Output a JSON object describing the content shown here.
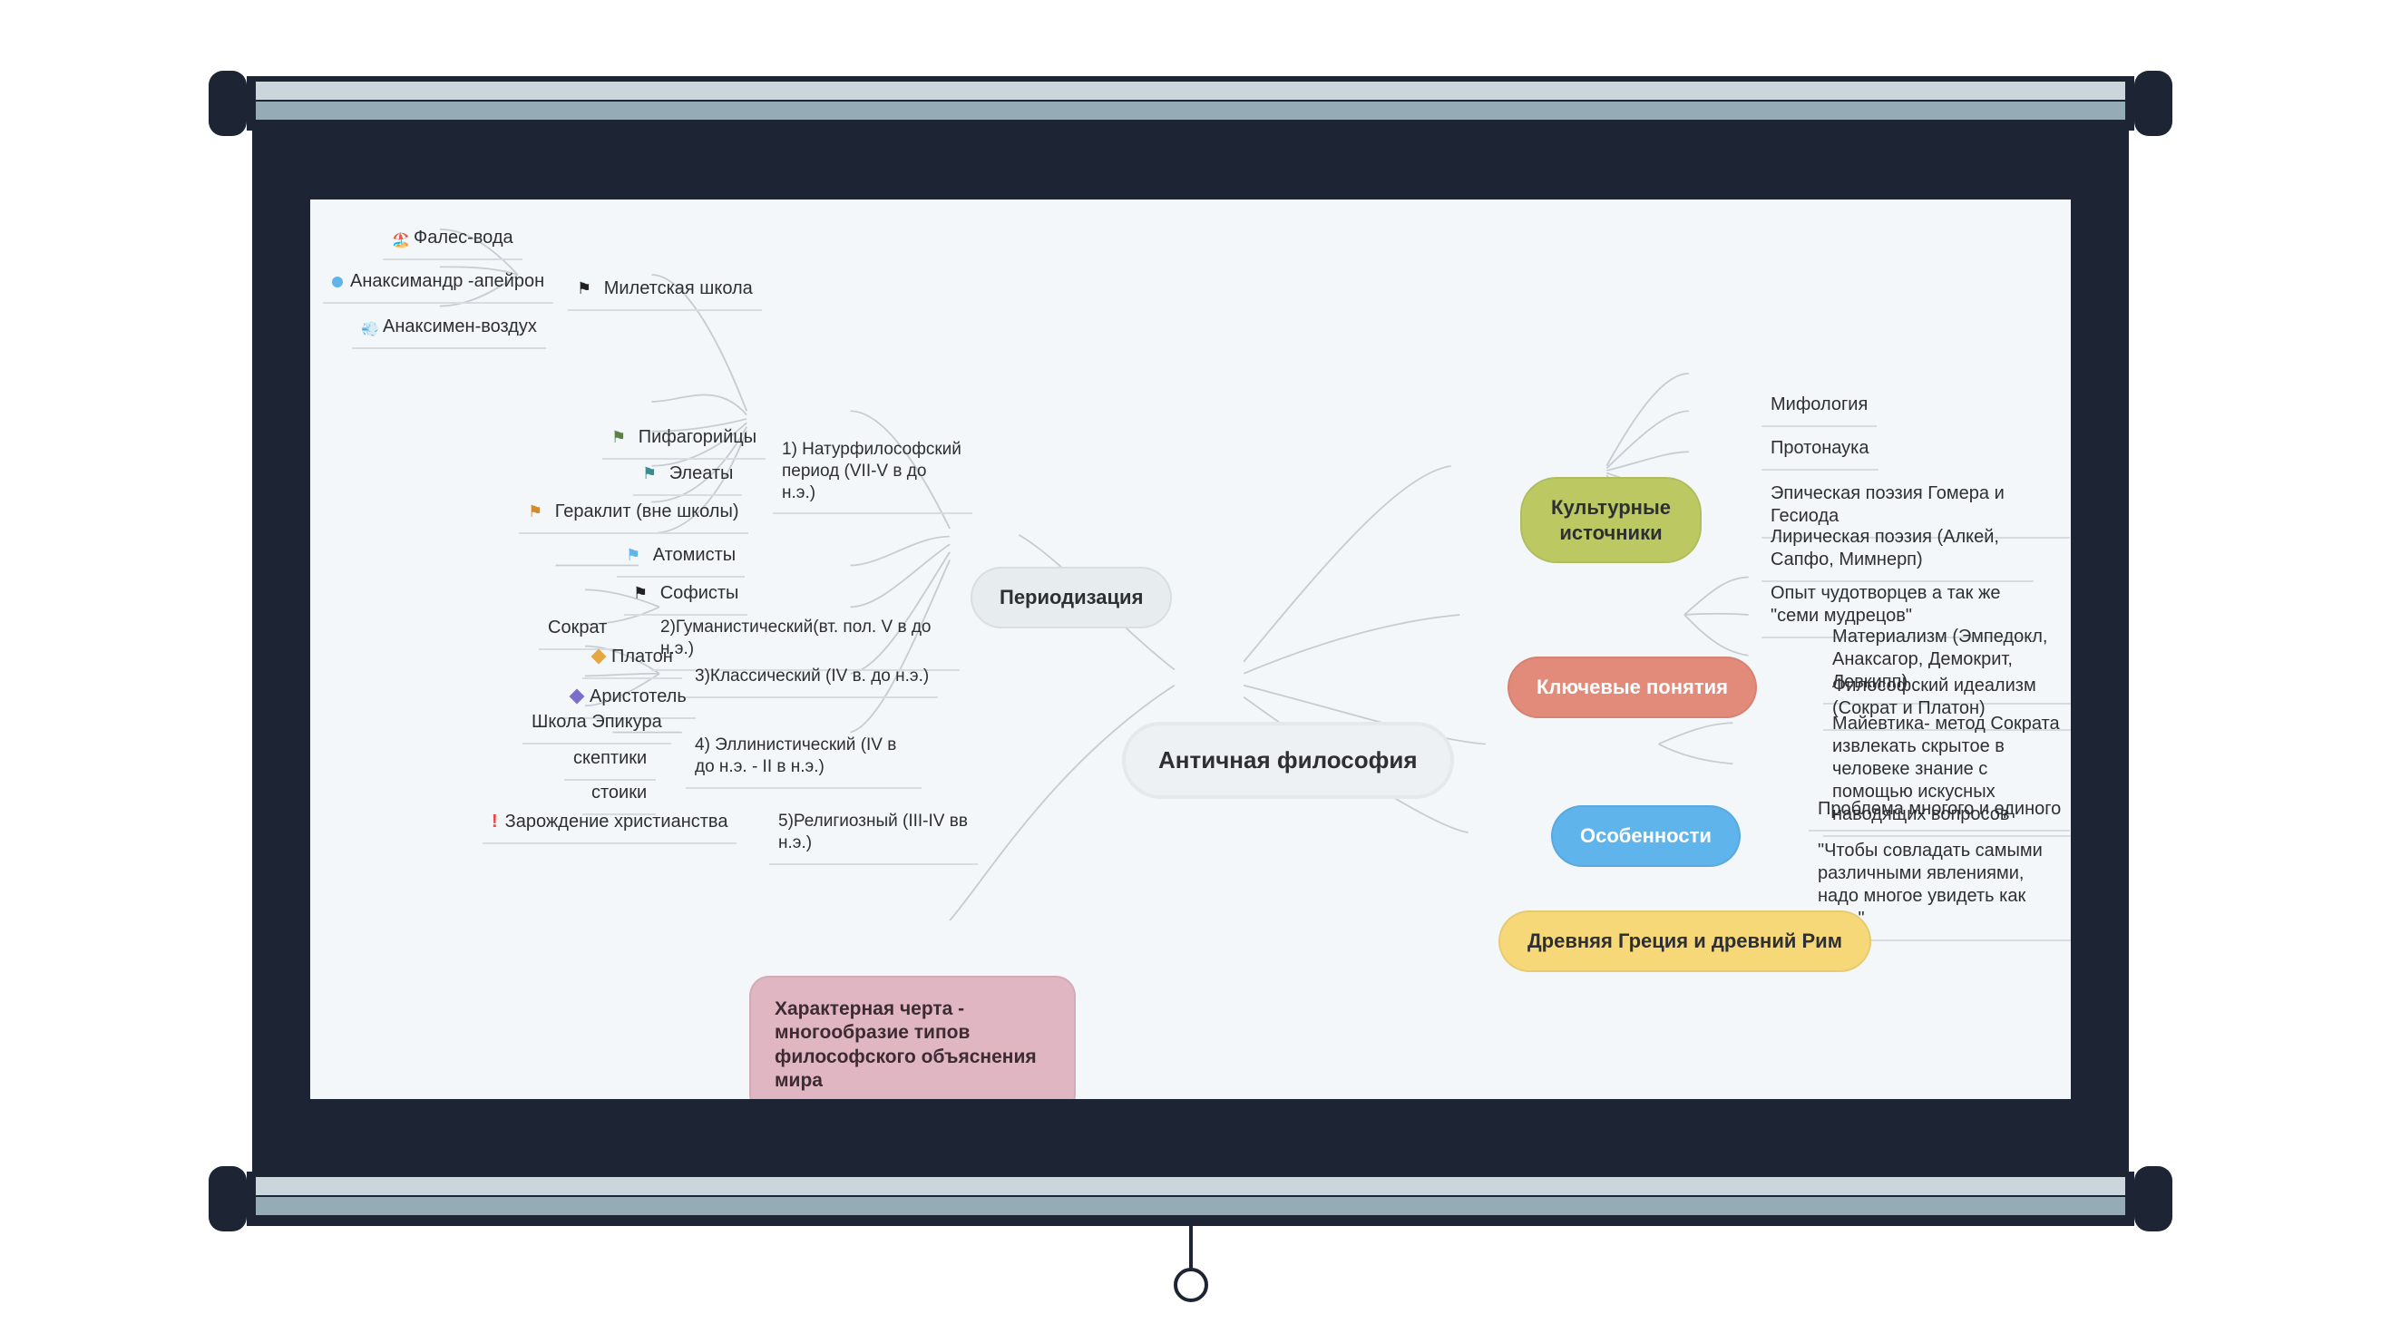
{
  "root": {
    "label": "Античная философия"
  },
  "left": {
    "periodization": {
      "label": "Периодизация"
    },
    "period1": {
      "label": "1) Натурфилософский период (VII-V в до н.э.)"
    },
    "p1": {
      "miletskaya": "Милетская школа",
      "m1": "Фалес-вода",
      "m2": "Анаксимандр -апейрон",
      "m3": "Анаксимен-воздух",
      "pythag": "Пифагорийцы",
      "eleats": "Элеаты",
      "heracl": "Гераклит (вне школы)",
      "atom": "Атомисты",
      "soph": "Софисты"
    },
    "period2": {
      "label": "2)Гуманистический(вт. пол. V в до н.э.)"
    },
    "p2": {
      "socrates": "Сократ"
    },
    "period3": {
      "label": "3)Классический (IV в. до н.э.)"
    },
    "p3": {
      "plato": "Платон",
      "arist": "Аристотель"
    },
    "period4": {
      "label": "4) Эллинистический (IV в до н.э. - II в н.э.)"
    },
    "p4": {
      "epicur": "Школа Эпикура",
      "scept": "скептики",
      "stoic": "стоики"
    },
    "period5": {
      "label": "5)Религиозный (III-IV вв н.э.)"
    },
    "p5": {
      "christ": "Зарождение христианства"
    },
    "feature": "Характерная черта - многообразие типов философского объяснения мира"
  },
  "right": {
    "sources": {
      "label": "Культурные источники",
      "items": [
        "Мифология",
        "Протонаука",
        "Эпическая поэзия Гомера и Гесиода",
        "Лирическая поэзия (Алкей, Сапфо, Мимнерп)",
        "Опыт чудотворцев а так же \"семи мудрецов\""
      ]
    },
    "concepts": {
      "label": "Ключевые понятия",
      "items": [
        "Материализм (Эмпедокл, Анаксагор, Демокрит, Левкипп)",
        "Философский идеализм (Сократ и Платон)",
        "Майевтика- метод Сократа извлекать скрытое в человеке знание с помощью искусных наводящих вопросов"
      ]
    },
    "features": {
      "label": "Особенности",
      "items": [
        "Проблема многого и единого",
        "\"Чтобы совладать самыми различными явлениями, надо многое увидеть как одно\""
      ]
    },
    "origin": {
      "label": "Древняя Греция и древний Рим"
    }
  }
}
